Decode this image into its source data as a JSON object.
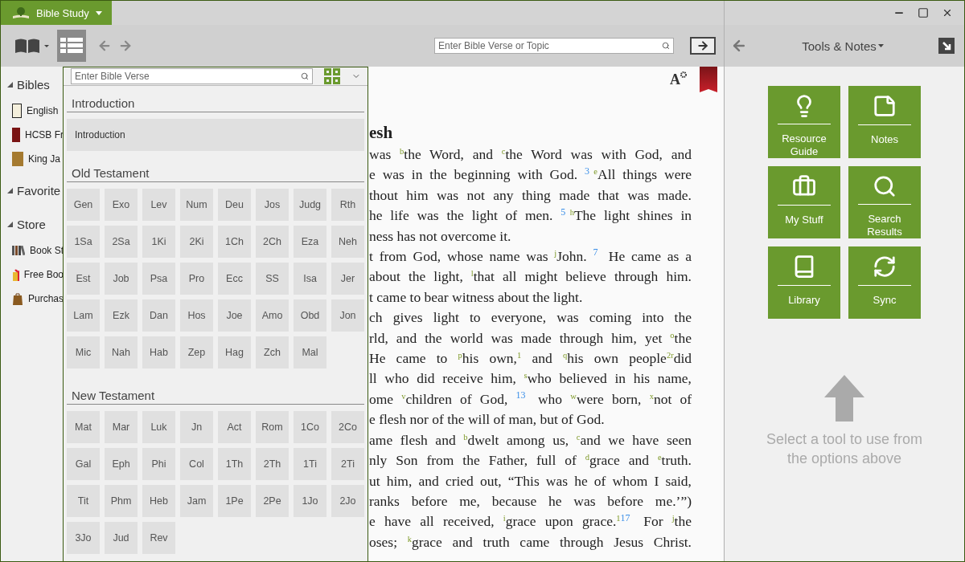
{
  "window": {
    "app_menu": "Bible Study"
  },
  "toolbar": {
    "contents_open": true,
    "search": {
      "placeholder": "Enter Bible Verse or Topic"
    }
  },
  "sidebar": {
    "sections": [
      {
        "title": "Bibles",
        "expanded": true,
        "items": [
          {
            "label": "English",
            "kind": "bible-white"
          },
          {
            "label": "HCSB Fr",
            "kind": "bible-red"
          },
          {
            "label": "King Ja",
            "kind": "bible-gold"
          }
        ]
      },
      {
        "title": "Favorite",
        "expanded": true
      },
      {
        "title": "Store",
        "expanded": true,
        "items": [
          {
            "label": "Book St",
            "kind": "books"
          },
          {
            "label": "Free Boo",
            "kind": "gift"
          },
          {
            "label": "Purchas",
            "kind": "bag"
          }
        ]
      }
    ]
  },
  "reader": {
    "text_settings": "A",
    "heading": "esh",
    "lines": [
      {
        "justify": true,
        "parts": [
          "was ",
          {
            "kind": "note",
            "text": "b"
          },
          "the Word, and ",
          {
            "kind": "note",
            "text": "c"
          },
          "the Word was with God, and"
        ]
      },
      {
        "justify": true,
        "parts": [
          "e was in the beginning with God. ",
          {
            "kind": "verse",
            "text": "3"
          },
          {
            "kind": "note",
            "text": "e"
          },
          "All things were"
        ]
      },
      {
        "justify": true,
        "parts": [
          "thout him was not any thing made that was made."
        ]
      },
      {
        "justify": true,
        "parts": [
          "he life was the light of men. ",
          {
            "kind": "verse",
            "text": "5"
          },
          {
            "kind": "note",
            "text": "h"
          },
          "The light shines in"
        ]
      },
      {
        "justify": false,
        "parts": [
          "ness has not overcome it."
        ]
      },
      {
        "justify": true,
        "parts": [
          "t from God, whose name was ",
          {
            "kind": "note",
            "text": "j"
          },
          "John. ",
          {
            "kind": "verse",
            "text": "7"
          },
          " He came as a"
        ]
      },
      {
        "justify": true,
        "parts": [
          "about the light, ",
          {
            "kind": "note",
            "text": "l"
          },
          "that all might believe through him."
        ]
      },
      {
        "justify": false,
        "parts": [
          "t came to bear witness about the light."
        ]
      },
      {
        "justify": true,
        "parts": [
          "ch gives light to everyone, was coming into the"
        ]
      },
      {
        "justify": true,
        "parts": [
          "rld, and the world was made through him, yet ",
          {
            "kind": "note",
            "text": "o"
          },
          "the"
        ]
      },
      {
        "justify": true,
        "parts": [
          "He came to ",
          {
            "kind": "note",
            "text": "p"
          },
          "his own,",
          {
            "kind": "note",
            "text": "1"
          },
          " and ",
          {
            "kind": "note",
            "text": "q"
          },
          "his own people",
          {
            "kind": "note",
            "text": "2"
          },
          {
            "kind": "note",
            "text": "r"
          },
          "did"
        ]
      },
      {
        "justify": true,
        "parts": [
          "ll who did receive him, ",
          {
            "kind": "note",
            "text": "s"
          },
          "who believed in his name,"
        ]
      },
      {
        "justify": true,
        "parts": [
          "ome ",
          {
            "kind": "note",
            "text": "v"
          },
          "children of God, ",
          {
            "kind": "verse",
            "text": "13"
          },
          " who ",
          {
            "kind": "note",
            "text": "w"
          },
          "were born, ",
          {
            "kind": "note",
            "text": "x"
          },
          "not of"
        ]
      },
      {
        "justify": false,
        "parts": [
          "e flesh nor of the will of man, but of God."
        ]
      },
      {
        "justify": true,
        "parts": [
          "ame flesh and ",
          {
            "kind": "note",
            "text": "b"
          },
          "dwelt among us, ",
          {
            "kind": "note",
            "text": "c"
          },
          "and we have seen"
        ]
      },
      {
        "justify": true,
        "parts": [
          "nly Son from the Father, full of ",
          {
            "kind": "note",
            "text": "d"
          },
          "grace and ",
          {
            "kind": "note",
            "text": "e"
          },
          "truth."
        ]
      },
      {
        "justify": true,
        "parts": [
          "ut him, and cried out, “This was he of whom I said,"
        ]
      },
      {
        "justify": true,
        "parts": [
          "ranks before me, because he was before me.’”)"
        ]
      },
      {
        "justify": true,
        "parts": [
          "e have all received, ",
          {
            "kind": "note",
            "text": "i"
          },
          "grace upon grace.",
          {
            "kind": "note",
            "text": "1"
          },
          {
            "kind": "verse",
            "text": "17"
          },
          " For ",
          {
            "kind": "note",
            "text": "j"
          },
          "the"
        ]
      },
      {
        "justify": true,
        "parts": [
          "oses; ",
          {
            "kind": "note",
            "text": "k"
          },
          "grace and truth came through Jesus Christ."
        ]
      }
    ]
  },
  "navigator": {
    "search": {
      "placeholder": "Enter Bible Verse"
    },
    "sections": [
      {
        "title": "Introduction",
        "kind": "list",
        "items": [
          "Introduction"
        ]
      },
      {
        "title": "Old Testament",
        "kind": "grid",
        "items": [
          "Gen",
          "Exo",
          "Lev",
          "Num",
          "Deu",
          "Jos",
          "Judg",
          "Rth",
          "1Sa",
          "2Sa",
          "1Ki",
          "2Ki",
          "1Ch",
          "2Ch",
          "Eza",
          "Neh",
          "Est",
          "Job",
          "Psa",
          "Pro",
          "Ecc",
          "SS",
          "Isa",
          "Jer",
          "Lam",
          "Ezk",
          "Dan",
          "Hos",
          "Joe",
          "Amo",
          "Obd",
          "Jon",
          "Mic",
          "Nah",
          "Hab",
          "Zep",
          "Hag",
          "Zch",
          "Mal"
        ]
      },
      {
        "title": "New Testament",
        "kind": "grid",
        "items": [
          "Mat",
          "Mar",
          "Luk",
          "Jn",
          "Act",
          "Rom",
          "1Co",
          "2Co",
          "Gal",
          "Eph",
          "Phi",
          "Col",
          "1Th",
          "2Th",
          "1Ti",
          "2Ti",
          "Tit",
          "Phm",
          "Heb",
          "Jam",
          "1Pe",
          "2Pe",
          "1Jo",
          "2Jo",
          "3Jo",
          "Jud",
          "Rev"
        ]
      }
    ]
  },
  "tools_panel": {
    "title": "Tools & Notes",
    "tools": [
      {
        "label": "Resource Guide",
        "kind": "resource"
      },
      {
        "label": "Notes",
        "kind": "notes"
      },
      {
        "label": "My Stuff",
        "kind": "stuff"
      },
      {
        "label": "Search Results",
        "kind": "search"
      },
      {
        "label": "Library",
        "kind": "library"
      },
      {
        "label": "Sync",
        "kind": "sync"
      }
    ],
    "hint": "Select a tool to use from the options above"
  }
}
